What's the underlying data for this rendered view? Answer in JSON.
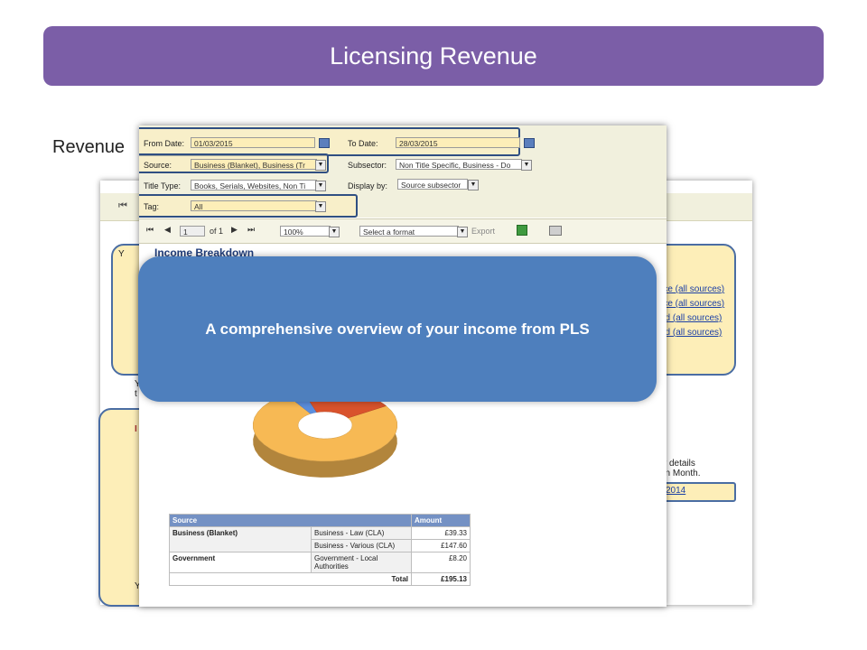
{
  "slide": {
    "title": "Licensing Revenue",
    "revenue_label": "Revenue"
  },
  "back_report": {
    "links": [
      "rce (all sources)",
      "rce (all sources)",
      "ed (all sources)",
      "ed (all sources)"
    ],
    "details_lines": [
      "w details",
      "on Month."
    ],
    "date_link": "2014",
    "left_snippet_top": "Y",
    "left_snippet_top2": "t",
    "left_snippet_mid": "I",
    "left_snippet_bottom": "Y"
  },
  "params": {
    "from_date_label": "From Date:",
    "from_date_value": "01/03/2015",
    "to_date_label": "To Date:",
    "to_date_value": "28/03/2015",
    "source_label": "Source:",
    "source_value": "Business (Blanket), Business (Tr",
    "subsector_label": "Subsector:",
    "subsector_value": "Non Title Specific, Business - Do",
    "title_type_label": "Title Type:",
    "title_type_value": "Books, Serials, Websites, Non Ti",
    "display_by_label": "Display by:",
    "display_by_value": "Source subsector",
    "tag_label": "Tag:",
    "tag_value": "All"
  },
  "pager": {
    "page_value": "1",
    "of_label": "of 1",
    "zoom_value": "100%",
    "format_value": "Select a format",
    "export_label": "Export"
  },
  "report": {
    "income_title": "Income Breakdown"
  },
  "table": {
    "headers": [
      "Source",
      "Amount"
    ],
    "rows": [
      {
        "source": "Business (Blanket)",
        "sub": "Business - Law (CLA)",
        "amount": "£39.33"
      },
      {
        "source": "",
        "sub": "Business - Various (CLA)",
        "amount": "£147.60"
      },
      {
        "source": "Government",
        "sub": "Government - Local Authorities",
        "amount": "£8.20"
      }
    ],
    "total_label": "Total",
    "total_value": "£195.13"
  },
  "chart_data": {
    "type": "pie",
    "categories": [],
    "values": [
      75,
      4,
      21
    ],
    "colors": [
      "#f7b954",
      "#5b8ede",
      "#d9532c"
    ]
  },
  "callout": {
    "text": "A comprehensive overview of your income from PLS"
  },
  "colors": {
    "banner": "#7b5ea7",
    "callout": "#4e7fbd",
    "highlight_border": "#2f4f82",
    "panel_fill": "#fdeeb8",
    "table_header": "#7491c4"
  }
}
